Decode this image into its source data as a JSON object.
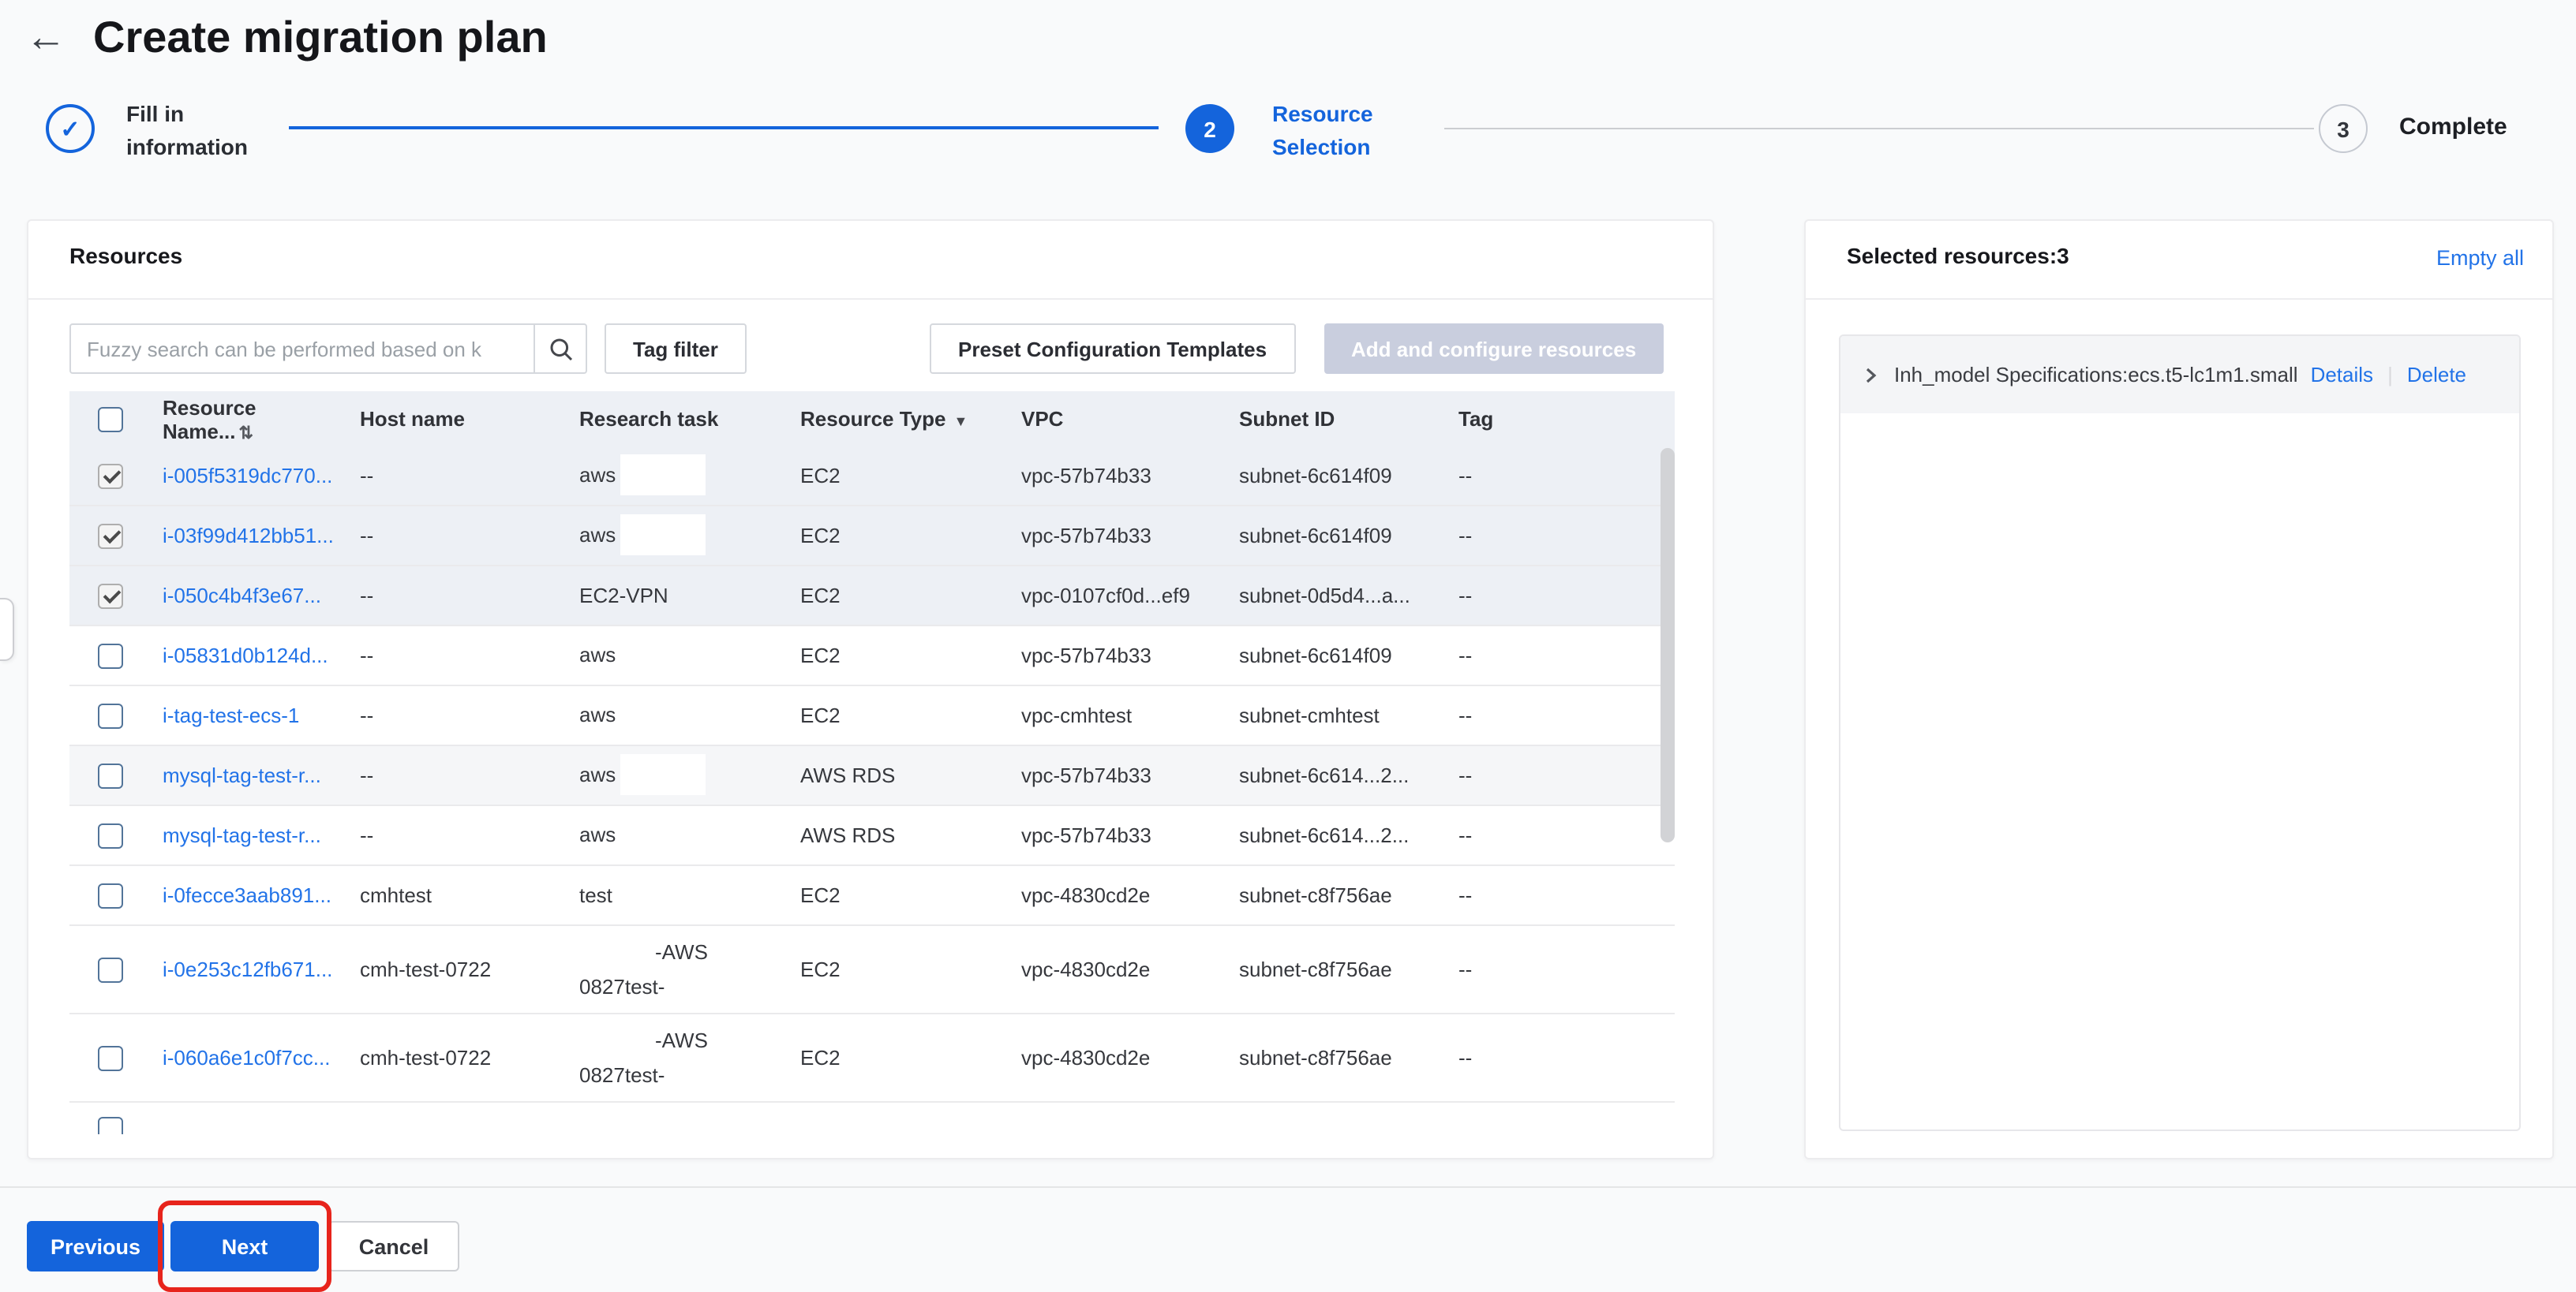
{
  "header": {
    "title": "Create migration plan"
  },
  "stepper": {
    "steps": [
      {
        "number": "1",
        "label_lines": [
          "Fill in",
          "information"
        ],
        "status": "done",
        "icon": "check"
      },
      {
        "number": "2",
        "label_lines": [
          "Resource",
          "Selection"
        ],
        "status": "current"
      },
      {
        "number": "3",
        "label_lines": [
          "Complete"
        ],
        "status": "upcoming"
      }
    ]
  },
  "resources": {
    "title": "Resources",
    "search": {
      "placeholder": "Fuzzy search can be performed based on k",
      "value": ""
    },
    "tag_filter": "Tag filter",
    "preset_templates": "Preset Configuration Templates",
    "add_configure": "Add and configure resources",
    "table": {
      "headers": {
        "resource_name": "Resource Name...",
        "host_name": "Host name",
        "research_task": "Research task",
        "resource_type": "Resource Type",
        "vpc": "VPC",
        "subnet_id": "Subnet ID",
        "tag": "Tag"
      },
      "rows": [
        {
          "checked": true,
          "state": "sel",
          "name": "i-005f5319dc770...",
          "host": "--",
          "research": {
            "text": "aws",
            "redact": "after"
          },
          "type": "EC2",
          "vpc": "vpc-57b74b33",
          "subnet": "subnet-6c614f09",
          "tag": "--"
        },
        {
          "checked": true,
          "state": "sel",
          "name": "i-03f99d412bb51...",
          "host": "--",
          "research": {
            "text": "aws",
            "redact": "after"
          },
          "type": "EC2",
          "vpc": "vpc-57b74b33",
          "subnet": "subnet-6c614f09",
          "tag": "--"
        },
        {
          "checked": true,
          "state": "sel",
          "name": "i-050c4b4f3e67...",
          "host": "--",
          "research": {
            "text": "EC2-VPN",
            "redact": "none"
          },
          "type": "EC2",
          "vpc": "vpc-0107cf0d...ef9",
          "subnet": "subnet-0d5d4...a...",
          "tag": "--"
        },
        {
          "checked": false,
          "state": "",
          "name": "i-05831d0b124d...",
          "host": "--",
          "research": {
            "text": "aws",
            "redact": "after"
          },
          "type": "EC2",
          "vpc": "vpc-57b74b33",
          "subnet": "subnet-6c614f09",
          "tag": "--"
        },
        {
          "checked": false,
          "state": "",
          "name": "i-tag-test-ecs-1",
          "host": "--",
          "research": {
            "text": "aws",
            "redact": "after"
          },
          "type": "EC2",
          "vpc": "vpc-cmhtest",
          "subnet": "subnet-cmhtest",
          "tag": "--"
        },
        {
          "checked": false,
          "state": "hov",
          "name": "mysql-tag-test-r...",
          "host": "--",
          "research": {
            "text": "aws",
            "redact": "after"
          },
          "type": "AWS RDS",
          "vpc": "vpc-57b74b33",
          "subnet": "subnet-6c614...2...",
          "tag": "--"
        },
        {
          "checked": false,
          "state": "",
          "name": "mysql-tag-test-r...",
          "host": "--",
          "research": {
            "text": "aws",
            "redact": "after"
          },
          "type": "AWS RDS",
          "vpc": "vpc-57b74b33",
          "subnet": "subnet-6c614...2...",
          "tag": "--"
        },
        {
          "checked": false,
          "state": "",
          "name": "i-0fecce3aab891...",
          "host": "cmhtest",
          "research": {
            "text": "test",
            "redact": "none"
          },
          "type": "EC2",
          "vpc": "vpc-4830cd2e",
          "subnet": "subnet-c8f756ae",
          "tag": "--"
        },
        {
          "checked": false,
          "state": "tall",
          "name": "i-0e253c12fb671...",
          "host": "cmh-test-0722",
          "research": {
            "lines": [
              "-AWS",
              "0827test-"
            ],
            "redact": "wrap"
          },
          "type": "EC2",
          "vpc": "vpc-4830cd2e",
          "subnet": "subnet-c8f756ae",
          "tag": "--"
        },
        {
          "checked": false,
          "state": "tall",
          "name": "i-060a6e1c0f7cc...",
          "host": "cmh-test-0722",
          "research": {
            "lines": [
              "-AWS",
              "0827test-"
            ],
            "redact": "wrap"
          },
          "type": "EC2",
          "vpc": "vpc-4830cd2e",
          "subnet": "subnet-c8f756ae",
          "tag": "--"
        }
      ]
    }
  },
  "selected_panel": {
    "title": "Selected resources:3",
    "empty_all": "Empty all",
    "item": {
      "label": "Inh_model Specifications:ecs.t5-lc1m1.small",
      "details": "Details",
      "delete": "Delete"
    }
  },
  "footer": {
    "previous": "Previous",
    "next": "Next",
    "cancel": "Cancel"
  },
  "colors": {
    "accent_blue": "#1464dc",
    "link_blue": "#2273e8",
    "annotation_red": "#e7241c",
    "disabled_button_bg": "#c9cede",
    "table_header_bg": "#edf0f5",
    "selected_row_bg": "#edf0f5"
  }
}
